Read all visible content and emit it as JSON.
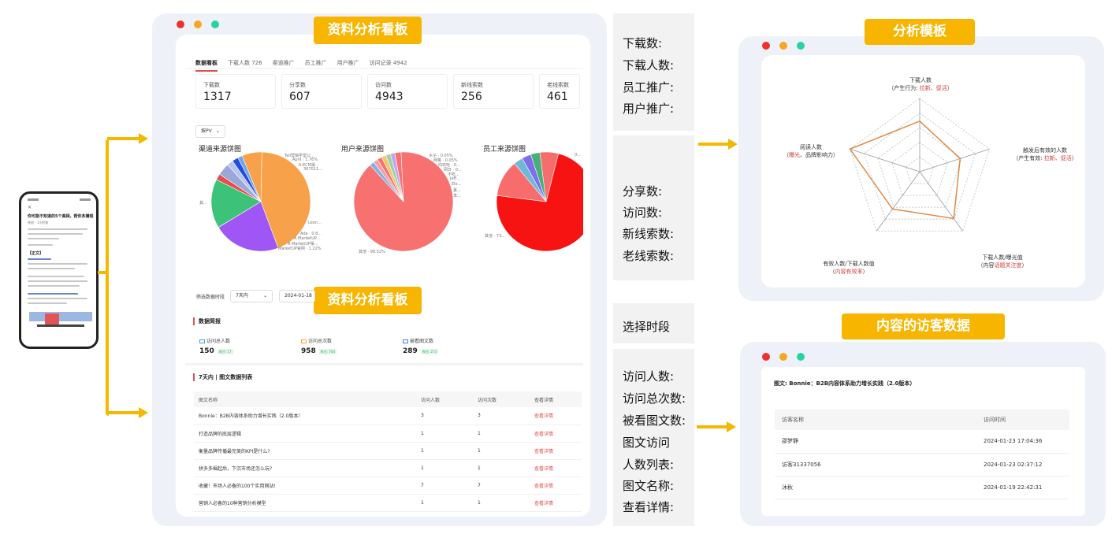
{
  "phone": {
    "title": "你可能不知道的5个真相，帮你多赚钱",
    "sub": "原创 · 1小时前",
    "section": "【正文】"
  },
  "dashboard1": {
    "badge": "资料分析看板",
    "tabs": [
      "数据看板",
      "下载人数 726",
      "渠道推广",
      "员工推广",
      "用户推广",
      "访问记录 4942"
    ],
    "stats": [
      {
        "label": "下载数",
        "value": "1317"
      },
      {
        "label": "分享数",
        "value": "607"
      },
      {
        "label": "访问数",
        "value": "4943"
      },
      {
        "label": "新线索数",
        "value": "256"
      },
      {
        "label": "老线索数",
        "value": "461"
      }
    ],
    "filter": "按PV",
    "pies": [
      {
        "title": "渠道来源饼图",
        "labels": [
          "Tell营销学堂公...",
          "April · 1.76%",
          "A·ECM渠...",
          "367011...",
          "Leon...",
          "Ada · 0.8...",
          "A MarketUP...",
          "A MarketUP渠...",
          "MarketUP官网 · 1.22%",
          "其..."
        ],
        "slices": [
          {
            "value": 44,
            "color": "#f7a24a"
          },
          {
            "value": 22,
            "color": "#a055f5"
          },
          {
            "value": 16,
            "color": "#3dc27a"
          },
          {
            "value": 2,
            "color": "#e84c4c"
          },
          {
            "value": 4,
            "color": "#9ba7d8"
          },
          {
            "value": 2,
            "color": "#b9c4ea"
          },
          {
            "value": 2,
            "color": "#1f4ee0"
          },
          {
            "value": 1.5,
            "color": "#6fa3f2"
          },
          {
            "value": 6.5,
            "color": "#f7a24a"
          }
        ]
      },
      {
        "title": "用户来源饼图",
        "labels": [
          "木子 · 0.05%",
          "网格 · 0.05%",
          "向欢哈 · 0...",
          "网日 · 0...",
          "不吃...",
          "Jeff...",
          "Ele...",
          "夏...",
          "李...",
          "其他 · 98.52%"
        ],
        "slices": [
          {
            "value": 89,
            "color": "#f77171"
          },
          {
            "value": 1.5,
            "color": "#7fb3e8"
          },
          {
            "value": 1.5,
            "color": "#f5a0a0"
          },
          {
            "value": 1.5,
            "color": "#f77171"
          },
          {
            "value": 1.5,
            "color": "#f5c56e"
          },
          {
            "value": 1.5,
            "color": "#9ad2a5"
          },
          {
            "value": 1.5,
            "color": "#c7a4f0"
          },
          {
            "value": 2,
            "color": "#f77171"
          }
        ]
      },
      {
        "title": "员工来源饼图",
        "labels": [
          "0...",
          "其他 · 73..."
        ],
        "slices": [
          {
            "value": 73,
            "color": "#f81313"
          },
          {
            "value": 12,
            "color": "#f76c6c"
          },
          {
            "value": 3,
            "color": "#6fb8d8"
          },
          {
            "value": 3,
            "color": "#7e6ee8"
          },
          {
            "value": 3,
            "color": "#45b07a"
          },
          {
            "value": 6,
            "color": "#f56d6d"
          }
        ]
      }
    ]
  },
  "dashboard2": {
    "badge": "资料分析看板",
    "filter_label": "筛选数据时段",
    "period": "7天内",
    "date": "2024-01-18",
    "summary_title": "数据简报",
    "summary": [
      {
        "label": "访问总人数",
        "value": "150",
        "change": "昨日: 17",
        "color": "#3aa6d8"
      },
      {
        "label": "访问总次数",
        "value": "958",
        "change": "昨日: 704",
        "color": "#f5a623"
      },
      {
        "label": "被看图文数",
        "value": "289",
        "change": "昨日: 273",
        "color": "#3d7fe0"
      }
    ],
    "list_title": "7天内 | 图文数据列表",
    "columns": [
      "图文名称",
      "访问人数",
      "访问次数",
      "查看详情"
    ],
    "rows": [
      [
        "Bonnie：B2B内容体系助力增长实践（2.0版本）",
        "3",
        "3",
        "查看详情"
      ],
      [
        "打造品牌的底层逻辑",
        "1",
        "1",
        "查看详情"
      ],
      [
        "衡量品牌传播最完美的KPI是什么?",
        "1",
        "1",
        "查看详情"
      ],
      [
        "拼多多崛起后，下沉市场还怎么玩?",
        "1",
        "1",
        "查看详情"
      ],
      [
        "收藏！市场人必备的100个实用网站!",
        "7",
        "7",
        "查看详情"
      ],
      [
        "营销人必备的10种营销分析模型",
        "1",
        "1",
        "查看详情"
      ]
    ]
  },
  "legend_boxes": [
    [
      "下载数:",
      "下载人数:",
      "员工推广:",
      "用户推广:"
    ],
    [
      "分享数:",
      "访问数:",
      "新线索数:",
      "老线索数:"
    ],
    [
      "选择时段"
    ],
    [
      "访问人数:",
      "访问总次数:",
      "被看图文数:",
      "图文访问",
      "人数列表:",
      "图文名称:",
      "查看详情:"
    ]
  ],
  "radar": {
    "badge": "分析模板",
    "axes": [
      {
        "title": "下载人数",
        "sub_prefix": "（产生行为: ",
        "sub_red": "拉新、促活",
        "sub_suffix": "）",
        "value": 0.69
      },
      {
        "title": "触发后有效的人数",
        "sub_prefix": "（产生有效: ",
        "sub_red": "拉新、促活",
        "sub_suffix": "）",
        "value": 0.58
      },
      {
        "title": "下载人数/曝光值",
        "sub_prefix": "（内容",
        "sub_red": "话题关注度",
        "sub_suffix": "）",
        "value": 0.79
      },
      {
        "title": "有效人数/下载人数值",
        "sub_prefix": "（",
        "sub_red": "内容有效率",
        "sub_suffix": "）",
        "value": 0.63
      },
      {
        "title": "阅读人数",
        "sub_prefix": "（",
        "sub_red": "曝光",
        "sub_suffix": "、品牌影响力）",
        "value": 1.0
      }
    ]
  },
  "visitors": {
    "badge": "内容的访客数据",
    "article": "图文: Bonnie：B2B内容体系助力增长实践（2.0版本）",
    "columns": [
      "访客名称",
      "访问时间"
    ],
    "rows": [
      [
        "邵梦静",
        "2024-01-23 17:04:36"
      ],
      [
        "访客31337056",
        "2024-01-23 02:37:12"
      ],
      [
        "沐秋",
        "2024-01-19 22:42:31"
      ]
    ]
  }
}
